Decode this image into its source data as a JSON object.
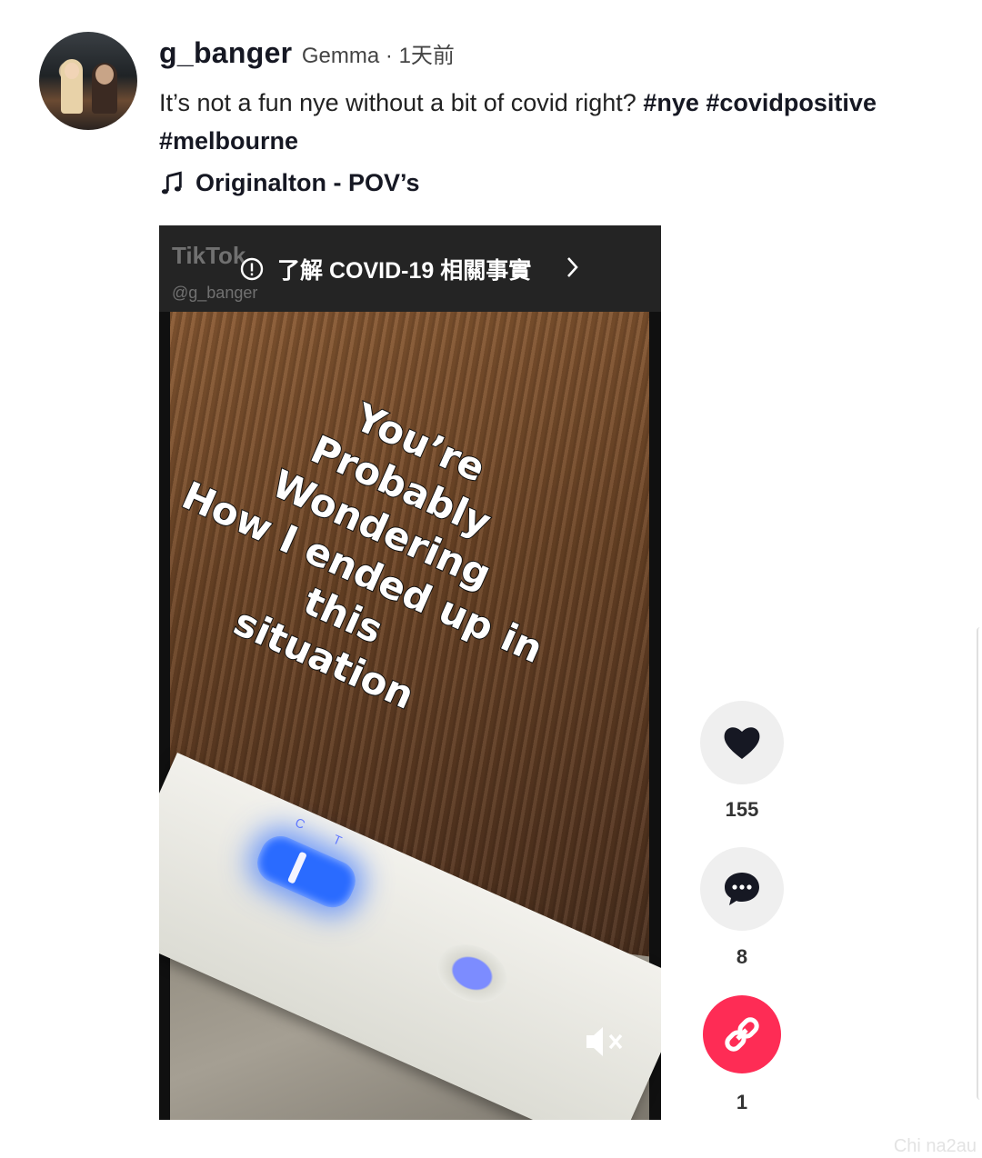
{
  "post": {
    "username": "g_banger",
    "nickname": "Gemma · 1天前",
    "caption_text": "It’s not a fun nye without a bit of covid right? ",
    "hashtags": [
      "#nye",
      "#covidpositive",
      "#melbourne"
    ],
    "music": "Originalton - POV’s"
  },
  "video": {
    "watermark": "TikTok",
    "watermark_handle": "@g_banger",
    "banner_text": "了解 COVID-19 相關事實",
    "overlay_lines": [
      "You’re",
      "Probably",
      "Wondering",
      "How I ended up in this",
      "situation"
    ],
    "test_labels": "C T",
    "muted_icon": "speaker-muted-icon"
  },
  "actions": {
    "likes": "155",
    "comments": "8",
    "shares": "1"
  },
  "colors": {
    "share_accent": "#fe2c55",
    "action_bg": "#efefef",
    "text": "#161823"
  },
  "footer_mark": "Chi na2au"
}
